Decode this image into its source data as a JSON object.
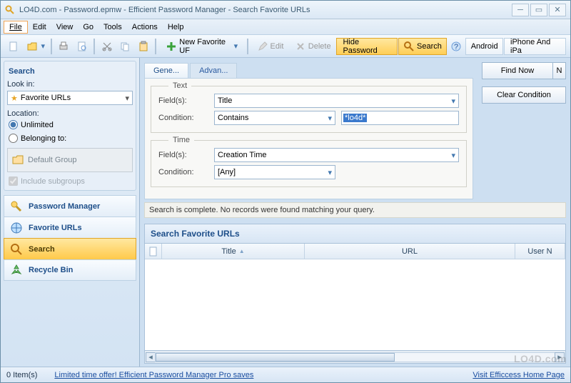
{
  "window": {
    "title": "LO4D.com - Password.epmw - Efficient Password Manager - Search Favorite URLs"
  },
  "menu": {
    "items": [
      "File",
      "Edit",
      "View",
      "Go",
      "Tools",
      "Actions",
      "Help"
    ],
    "active_index": 0
  },
  "toolbar": {
    "new_favorite": "New Favorite UF",
    "edit": "Edit",
    "delete": "Delete",
    "hide_password": "Hide Password",
    "search": "Search",
    "android": "Android",
    "iphone": "iPhone And iPa"
  },
  "sidebar": {
    "search_header": "Search",
    "look_in_label": "Look in:",
    "look_in_value": "Favorite URLs",
    "location_label": "Location:",
    "radio_unlimited": "Unlimited",
    "radio_belonging": "Belonging to:",
    "default_group": "Default Group",
    "include_subgroups": "Include subgroups",
    "nav": [
      {
        "label": "Password Manager",
        "icon": "key-icon"
      },
      {
        "label": "Favorite URLs",
        "icon": "globe-icon"
      },
      {
        "label": "Search",
        "icon": "search-icon"
      },
      {
        "label": "Recycle Bin",
        "icon": "recycle-icon"
      }
    ],
    "nav_active": 2
  },
  "form": {
    "tab_general": "Gene...",
    "tab_advanced": "Advan...",
    "legend_text": "Text",
    "legend_time": "Time",
    "fields_label": "Field(s):",
    "condition_label": "Condition:",
    "text_field_value": "Title",
    "text_condition_value": "Contains",
    "text_search_value": "*lo4d*",
    "time_field_value": "Creation Time",
    "time_condition_value": "[Any]",
    "find_now": "Find Now",
    "find_now_trunc": "N",
    "clear_condition": "Clear Condition"
  },
  "status_message": "Search is complete. No records were found matching your query.",
  "grid": {
    "title": "Search Favorite URLs",
    "col_icon": "",
    "col_title": "Title",
    "col_url": "URL",
    "col_user": "User N"
  },
  "statusbar": {
    "items_count": "0 Item(s)",
    "promo_link": "Limited time offer! Efficient Password Manager Pro saves",
    "home_link": "Visit Efficcess Home Page"
  },
  "watermark": "LO4D.com"
}
